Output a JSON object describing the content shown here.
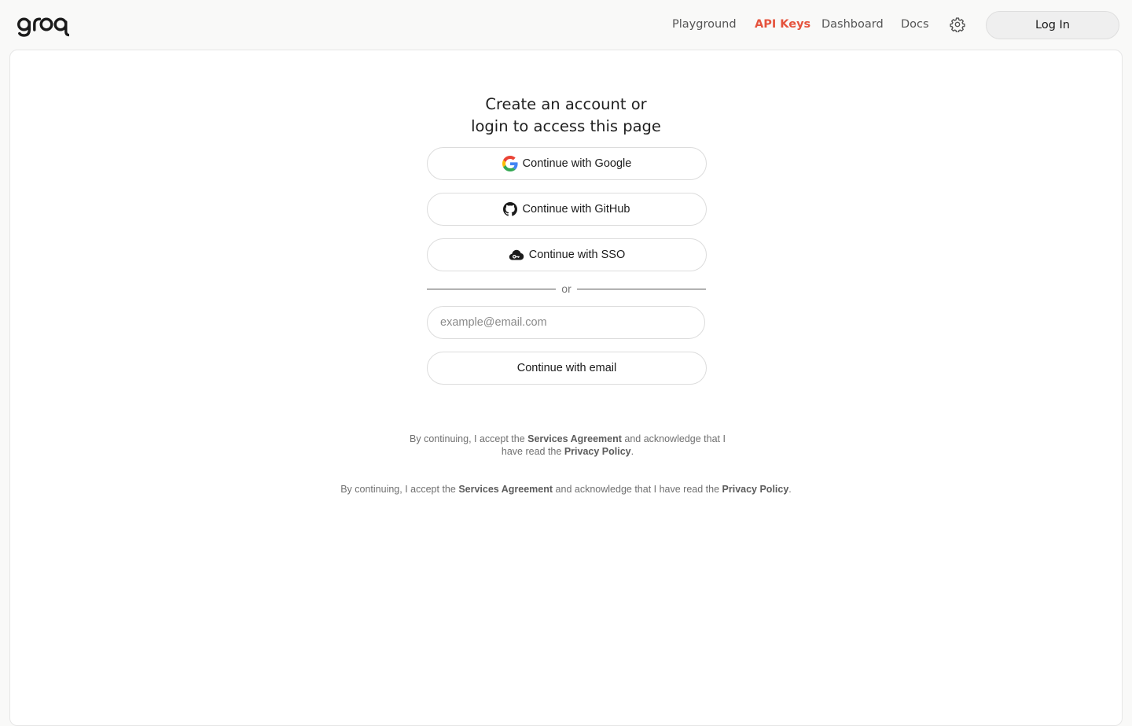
{
  "brand": {
    "logo_text": "groq",
    "accent": "#e5533d"
  },
  "nav": {
    "playground": "Playground",
    "api_keys": "API Keys",
    "dashboard": "Dashboard",
    "docs": "Docs",
    "settings_icon": "gear-icon",
    "login": "Log In"
  },
  "auth": {
    "heading_line1": "Create an account or",
    "heading_line2": "login to access this page",
    "google": "Continue with Google",
    "github": "Continue with GitHub",
    "sso": "Continue with SSO",
    "divider": "or",
    "email_placeholder": "example@email.com",
    "email_value": "",
    "continue_email": "Continue with email"
  },
  "legal": {
    "prefix": "By continuing, I accept the",
    "services": "Services Agreement",
    "middle": "and acknowledge that I have read the",
    "privacy": "Privacy Policy",
    "suffix": "."
  }
}
